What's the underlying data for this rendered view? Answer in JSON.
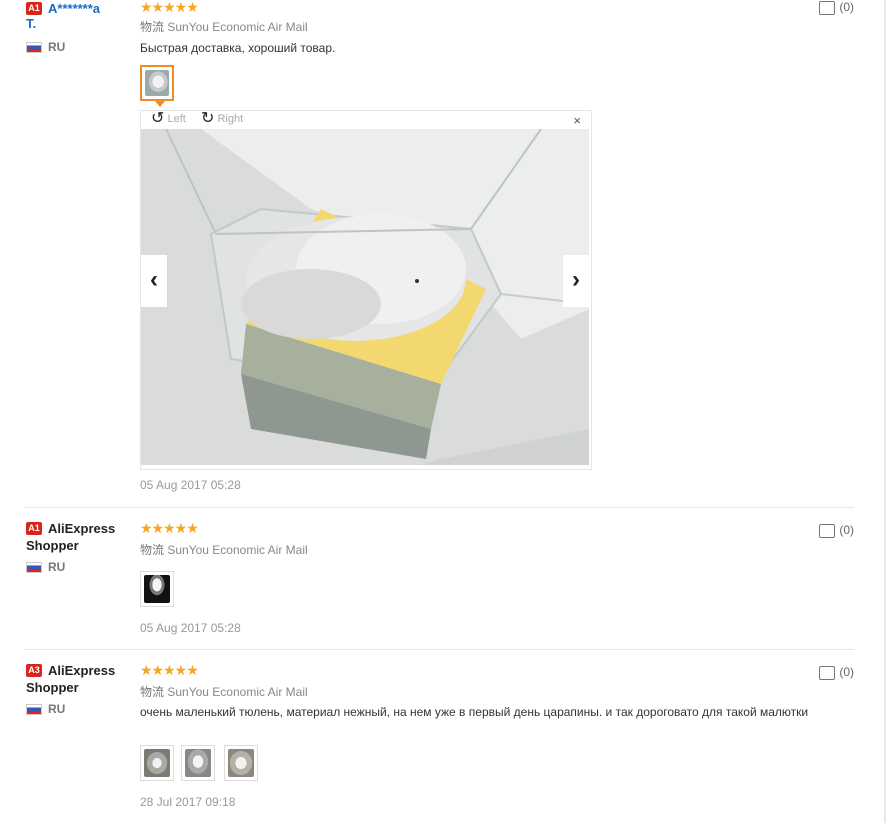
{
  "reviews": [
    {
      "badge": "A1",
      "user_line1": "A*******a",
      "user_line2": "T.",
      "country": "RU",
      "stars": "★★★★★",
      "logistics_cn": "物流",
      "logistics": "SunYou Economic Air Mail",
      "comment": "Быстрая доставка, хороший товар.",
      "date": "05 Aug 2017 05:28",
      "likes": "(0)"
    },
    {
      "badge": "A1",
      "user_line1": "AliExpress",
      "user_line2": "Shopper",
      "country": "RU",
      "stars": "★★★★★",
      "logistics_cn": "物流",
      "logistics": "SunYou Economic Air Mail",
      "date": "05 Aug 2017 05:28",
      "likes": "(0)"
    },
    {
      "badge": "A3",
      "user_line1": "AliExpress",
      "user_line2": "Shopper",
      "country": "RU",
      "stars": "★★★★★",
      "logistics_cn": "物流",
      "logistics": "SunYou Economic Air Mail",
      "comment": "очень маленький тюлень, материал нежный, на нем уже в первый день царапины. и так дороговато для такой малютки",
      "date": "28 Jul 2017 09:18",
      "likes": "(0)"
    }
  ],
  "viewer": {
    "rotate_left": "Left",
    "rotate_right": "Right",
    "close": "×",
    "prev": "‹",
    "next": "›"
  },
  "colors": {
    "star": "#f5a623",
    "badge": "#d9261c",
    "link": "#1a6bc6",
    "active_thumb": "#f08a24"
  }
}
